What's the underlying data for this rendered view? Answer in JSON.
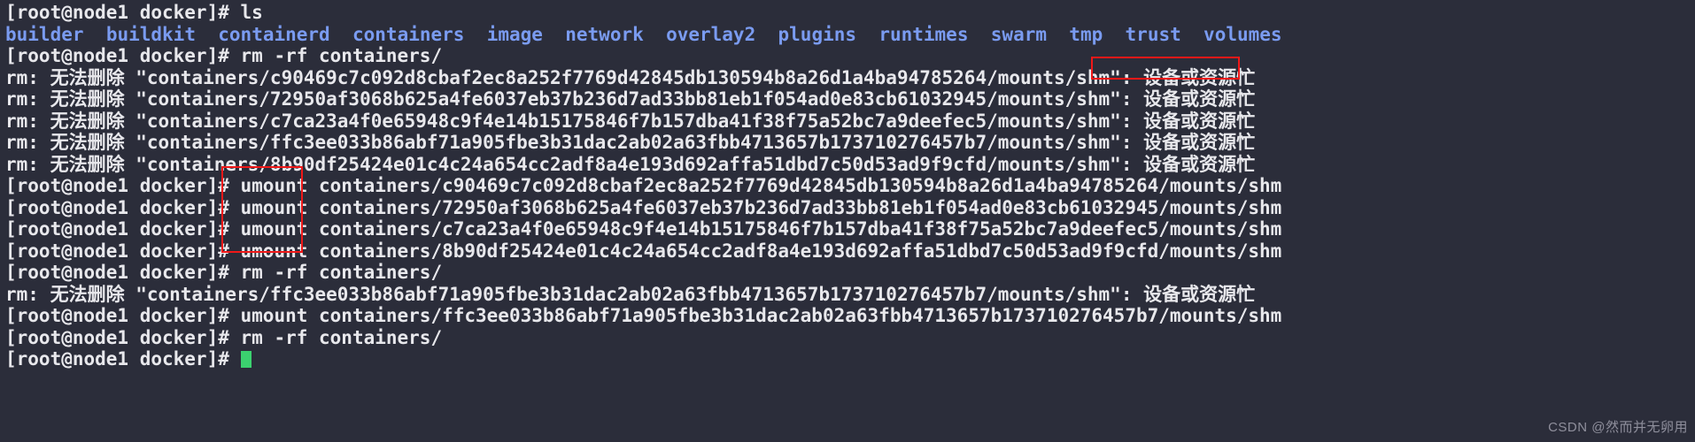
{
  "terminal": {
    "prompt": "[root@node1 docker]# ",
    "colors": {
      "background": "#2b2d3a",
      "foreground": "#e8e8ec",
      "directory": "#7a9bf0",
      "annotation": "#f01818",
      "cursor": "#3bd16f"
    },
    "commands": {
      "ls": "ls",
      "rm_rf": "rm -rf containers/",
      "umount": "umount"
    },
    "error_prefix": "rm: 无法删除 \"",
    "error_suffix": "\": ",
    "error_reason": "设备或资源忙",
    "mount_path": "/mounts/shm",
    "directories": [
      "builder",
      "buildkit",
      "containerd",
      "containers",
      "image",
      "network",
      "overlay2",
      "plugins",
      "runtimes",
      "swarm",
      "tmp",
      "trust",
      "volumes"
    ],
    "containers": [
      "c90469c7c092d8cbaf2ec8a252f7769d42845db130594b8a26d1a4ba94785264",
      "72950af3068b625a4fe6037eb37b236d7ad33bb81eb1f054ad0e83cb61032945",
      "c7ca23a4f0e65948c9f4e14b15175846f7b157dba41f38f75a52bc7a9deefec5",
      "ffc3ee033b86abf71a905fbe3b31dac2ab02a63fbb4713657b173710276457b7",
      "8b90df25424e01c4c24a654cc2adf8a4e193d692affa51dbd7c50d53ad9f9cfd"
    ],
    "lines": [
      {
        "id": "l1",
        "type": "prompt-cmd",
        "command": "ls"
      },
      {
        "id": "l2",
        "type": "dirlist"
      },
      {
        "id": "l3",
        "type": "prompt-cmd",
        "command": "rm -rf containers/"
      },
      {
        "id": "l4",
        "type": "error",
        "target": "containers/c90469c7c092d8cbaf2ec8a252f7769d42845db130594b8a26d1a4ba94785264/mounts/shm"
      },
      {
        "id": "l5",
        "type": "error",
        "target": "containers/72950af3068b625a4fe6037eb37b236d7ad33bb81eb1f054ad0e83cb61032945/mounts/shm"
      },
      {
        "id": "l6",
        "type": "error",
        "target": "containers/c7ca23a4f0e65948c9f4e14b15175846f7b157dba41f38f75a52bc7a9deefec5/mounts/shm"
      },
      {
        "id": "l7",
        "type": "error",
        "target": "containers/ffc3ee033b86abf71a905fbe3b31dac2ab02a63fbb4713657b173710276457b7/mounts/shm"
      },
      {
        "id": "l8",
        "type": "error",
        "target": "containers/8b90df25424e01c4c24a654cc2adf8a4e193d692affa51dbd7c50d53ad9f9cfd/mounts/shm"
      },
      {
        "id": "l9",
        "type": "prompt-cmd",
        "command": "umount containers/c90469c7c092d8cbaf2ec8a252f7769d42845db130594b8a26d1a4ba94785264/mounts/shm"
      },
      {
        "id": "l10",
        "type": "prompt-cmd",
        "command": "umount containers/72950af3068b625a4fe6037eb37b236d7ad33bb81eb1f054ad0e83cb61032945/mounts/shm"
      },
      {
        "id": "l11",
        "type": "prompt-cmd",
        "command": "umount containers/c7ca23a4f0e65948c9f4e14b15175846f7b157dba41f38f75a52bc7a9deefec5/mounts/shm"
      },
      {
        "id": "l12",
        "type": "prompt-cmd",
        "command": "umount containers/8b90df25424e01c4c24a654cc2adf8a4e193d692affa51dbd7c50d53ad9f9cfd/mounts/shm"
      },
      {
        "id": "l13",
        "type": "prompt-cmd",
        "command": "rm -rf containers/"
      },
      {
        "id": "l14",
        "type": "error",
        "target": "containers/ffc3ee033b86abf71a905fbe3b31dac2ab02a63fbb4713657b173710276457b7/mounts/shm"
      },
      {
        "id": "l15",
        "type": "prompt-cmd",
        "command": "umount containers/ffc3ee033b86abf71a905fbe3b31dac2ab02a63fbb4713657b173710276457b7/mounts/shm"
      },
      {
        "id": "l16",
        "type": "prompt-cmd",
        "command": "rm -rf containers/"
      },
      {
        "id": "l17",
        "type": "prompt-cursor",
        "command": ""
      }
    ]
  },
  "annotations": [
    {
      "id": "box-busy",
      "label": "device-or-resource-busy-highlight"
    },
    {
      "id": "box-umount",
      "label": "umount-command-highlight"
    }
  ],
  "watermark": "CSDN @然而并无卵用"
}
